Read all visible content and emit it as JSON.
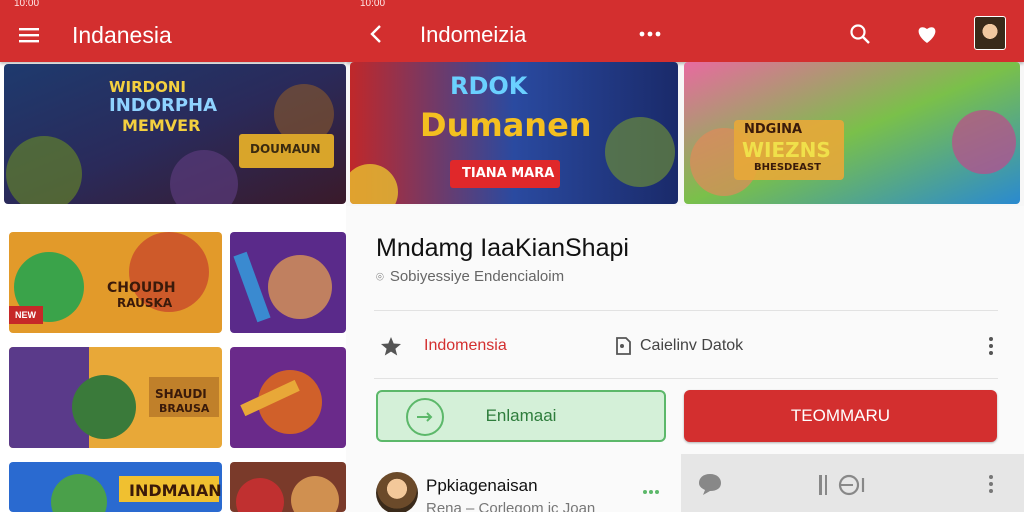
{
  "left_screen": {
    "status": {
      "time": "10:00"
    },
    "appbar": {
      "title": "Indanesia"
    },
    "banner": {
      "line1": "WIRDONI",
      "line2": "INDORPHA",
      "line3": "MEMVER",
      "badge": "DOUMAUN"
    },
    "cards": [
      {
        "label": "CHOUDH",
        "label2": "RAUSKA",
        "tag": "NEW"
      },
      {
        "label": ""
      },
      {
        "label": "SHAUDI",
        "label2": "BRAUSA"
      },
      {
        "label": ""
      },
      {
        "label": "INDMAIAN"
      },
      {
        "label": ""
      }
    ]
  },
  "right_screen": {
    "status": {
      "time": "10:00"
    },
    "appbar": {
      "title": "Indomeizia"
    },
    "banners": [
      {
        "line1": "RDOK",
        "line2": "Dumanen",
        "strip": "TIANA MARA"
      },
      {
        "line1": "NDGINA",
        "line2": "WIEZNS",
        "strip": "BHESDEAST"
      }
    ],
    "app_title": "Mndamg IaaKianShapi",
    "app_sub": "Sobiyessiye  Endencialoim",
    "meta": {
      "country": "Indomensia",
      "category": "Caielinv Datok"
    },
    "buttons": {
      "secondary": "Enlamaai",
      "primary": "TEOMMARU"
    },
    "developer": {
      "name": "Ppkiagenaisan",
      "sub": "Rena – Corlegom ic Joan"
    },
    "colors": {
      "primary": "#d32f2f",
      "accent_green": "#5cb86a"
    }
  }
}
